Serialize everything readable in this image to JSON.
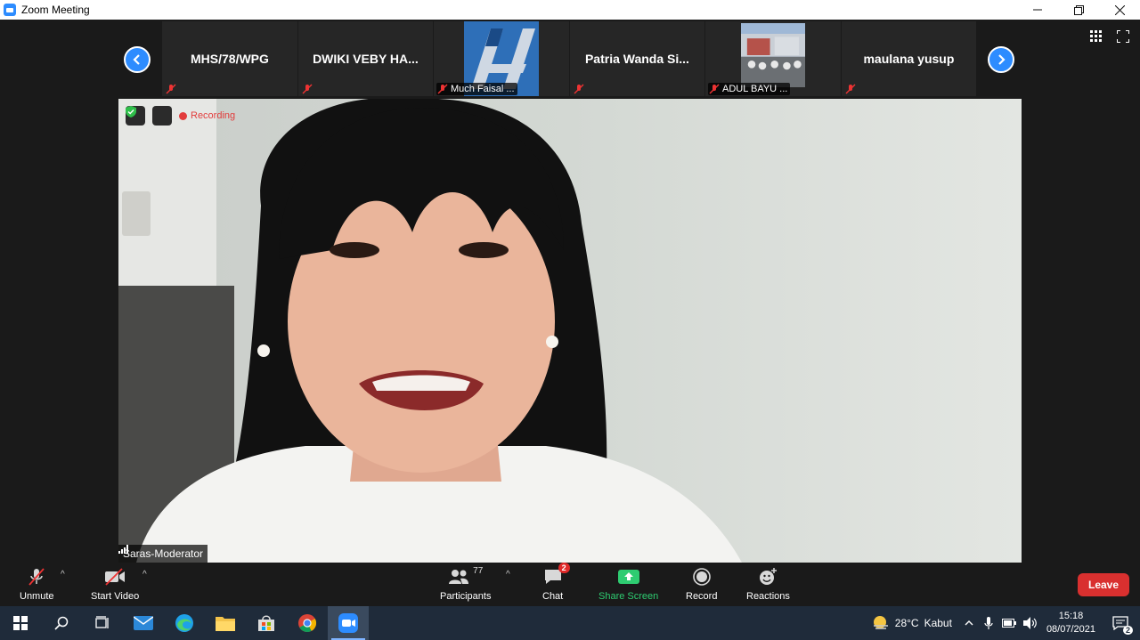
{
  "window": {
    "title": "Zoom Meeting"
  },
  "gallery": {
    "participants": [
      {
        "name": "MHS/78/WPG",
        "type": "text"
      },
      {
        "name": "DWIKI VEBY HA...",
        "type": "text"
      },
      {
        "name": "Much Faisal ...",
        "type": "image"
      },
      {
        "name": "Patria  Wanda  Si...",
        "type": "text"
      },
      {
        "name": "ADUL BAYU ...",
        "type": "image"
      },
      {
        "name": "maulana yusup",
        "type": "text"
      }
    ]
  },
  "speaker": {
    "name": "Saras-Moderator",
    "recording_label": "Recording"
  },
  "toolbar": {
    "unmute": "Unmute",
    "start_video": "Start Video",
    "participants": "Participants",
    "participants_count": "77",
    "chat": "Chat",
    "chat_badge": "2",
    "share_screen": "Share Screen",
    "record": "Record",
    "reactions": "Reactions",
    "leave": "Leave"
  },
  "taskbar": {
    "weather_temp": "28°C",
    "weather_desc": "Kabut",
    "time": "15:18",
    "date": "08/07/2021",
    "notifications": "2"
  },
  "colors": {
    "accent": "#2d8cff",
    "leave": "#d9302f",
    "share": "#2ecc71",
    "taskbar": "#1f2b3a"
  }
}
